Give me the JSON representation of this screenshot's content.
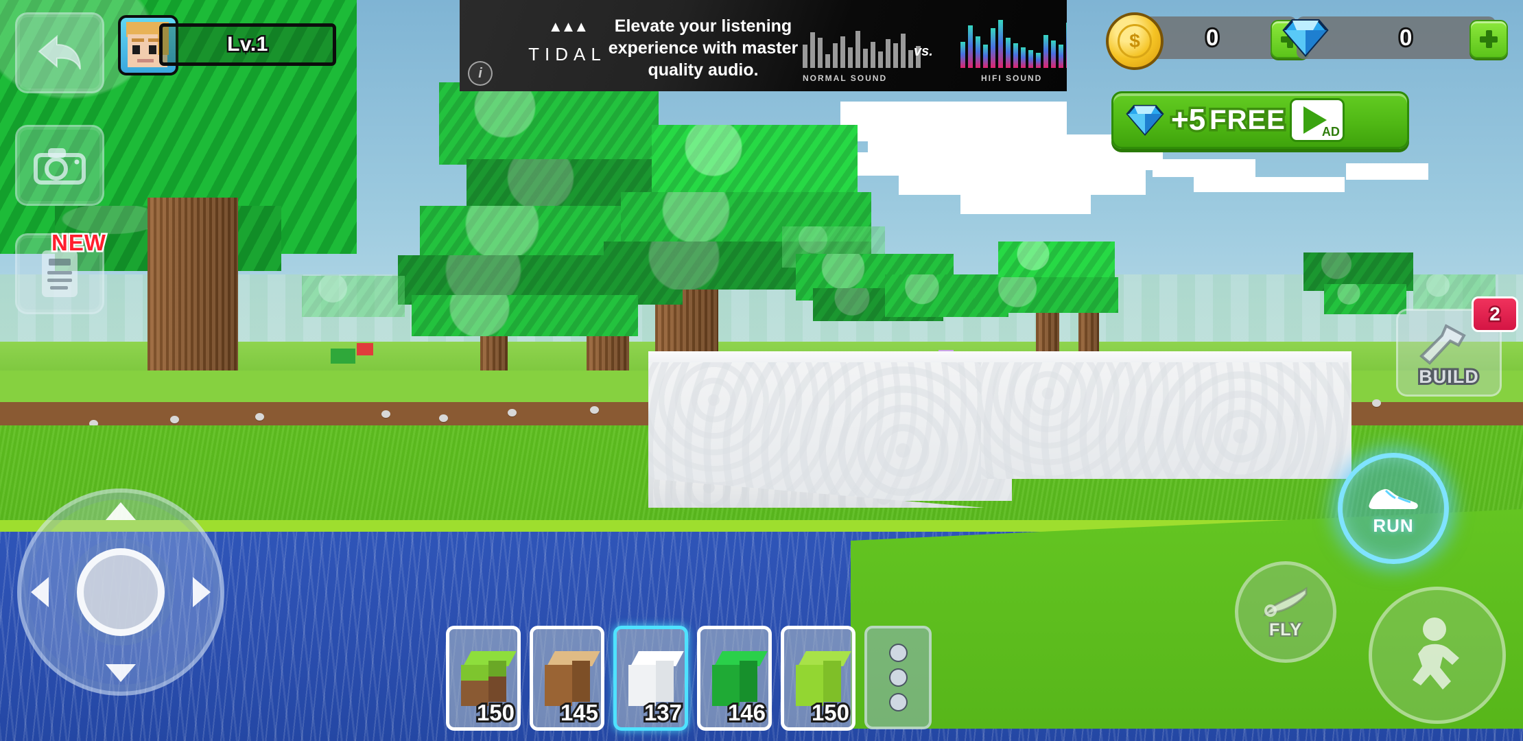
{
  "player": {
    "level_label": "Lv.1",
    "avatar_name": "player-avatar"
  },
  "left_controls": {
    "back_label": "back-arrow-icon",
    "camera_label": "camera-icon",
    "news_label": "news-icon",
    "new_badge": "NEW"
  },
  "currency": {
    "coins": "0",
    "gems": "0",
    "coin_icon": "gold-coin-icon",
    "gem_icon": "diamond-gem-icon",
    "add_label": "+"
  },
  "free_gems": {
    "amount": "+5",
    "free_label": "FREE",
    "ad_label": "AD"
  },
  "ad_banner": {
    "brand": "TIDAL",
    "brand_glyph": "▲▲▲",
    "headline": "Elevate your listening experience with master quality audio.",
    "vs_label": "vs.",
    "left_caption": "NORMAL SOUND",
    "right_caption": "HIFI SOUND",
    "info_label": "i"
  },
  "build": {
    "label": "BUILD",
    "count": "2"
  },
  "actions": {
    "run_label": "RUN",
    "fly_label": "FLY",
    "jump_label": "jump-button"
  },
  "dpad": {
    "up": "up-arrow",
    "down": "down-arrow",
    "left": "left-arrow",
    "right": "right-arrow",
    "knob": "joystick-knob"
  },
  "hotbar": {
    "slots": [
      {
        "name": "grass-block",
        "count": "150",
        "selected": false,
        "top": "#8ede3c",
        "left": "#7ec52e",
        "right": "#6aa826",
        "dirt": "#8a5a33"
      },
      {
        "name": "wood-log-block",
        "count": "145",
        "selected": false,
        "top": "#e0bb85",
        "left": "#9a6434",
        "right": "#7d4f27",
        "dirt": ""
      },
      {
        "name": "snow-block",
        "count": "137",
        "selected": true,
        "top": "#ffffff",
        "left": "#f0f2f4",
        "right": "#dfe3e7",
        "dirt": ""
      },
      {
        "name": "leaves-block",
        "count": "146",
        "selected": false,
        "top": "#2ad04a",
        "left": "#1faa35",
        "right": "#17902c",
        "dirt": ""
      },
      {
        "name": "bush-block",
        "count": "150",
        "selected": false,
        "top": "#a8e248",
        "left": "#93d632",
        "right": "#7fbf28",
        "dirt": ""
      }
    ],
    "more_label": "more-options"
  },
  "colors": {
    "sky_top": "#7fb4d4",
    "sky_bottom": "#cfe6ee",
    "grass": "#5fc020",
    "water": "#2f55b8",
    "dirt": "#8a5a33",
    "leaf": "#1faa37",
    "trunk": "#7d4f27",
    "snow": "#f3f4f5",
    "accent_green": "#4fb714",
    "accent_cyan": "#4fe2ff",
    "badge_red": "#d41544"
  }
}
